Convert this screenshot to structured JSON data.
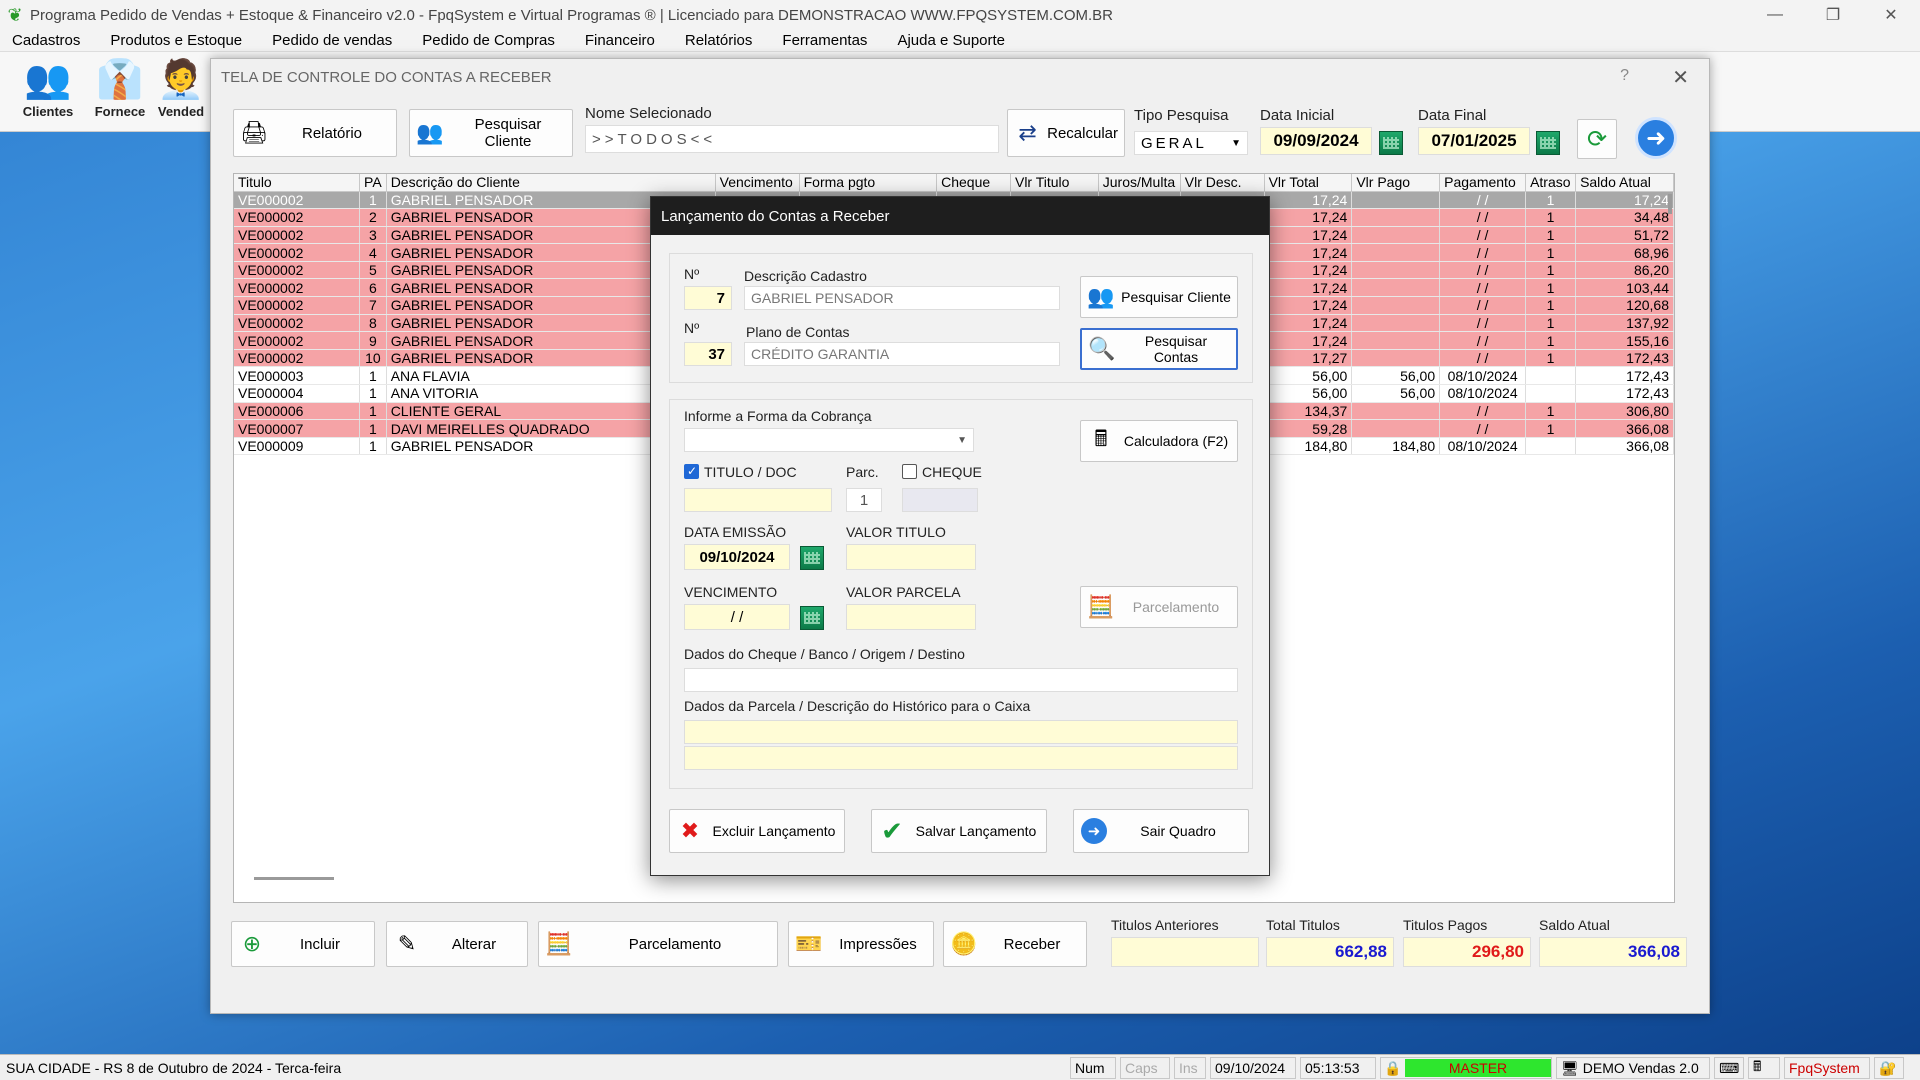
{
  "app": {
    "title": "Programa Pedido de Vendas + Estoque & Financeiro v2.0 - FpqSystem e Virtual Programas ® | Licenciado para  DEMONSTRACAO WWW.FPQSYSTEM.COM.BR",
    "window_controls": {
      "minimize": "—",
      "restore": "❐",
      "close": "✕"
    }
  },
  "menu": [
    "Cadastros",
    "Produtos e Estoque",
    "Pedido de vendas",
    "Pedido de Compras",
    "Financeiro",
    "Relatórios",
    "Ferramentas",
    "Ajuda e Suporte"
  ],
  "toolbar": [
    {
      "label": "Clientes",
      "icon": "people-icon"
    },
    {
      "label": "Fornece",
      "icon": "supplier-icon"
    },
    {
      "label": "Vended",
      "icon": "seller-icon"
    }
  ],
  "screen": {
    "title": "TELA DE CONTROLE DO CONTAS A RECEBER",
    "help": "?",
    "close": "✕",
    "btn_relatorio": "Relatório",
    "btn_pesquisar_cliente": "Pesquisar Cliente",
    "nome_selecionado_label": "Nome Selecionado",
    "nome_selecionado_value": ">>TODOS<<",
    "btn_recalcular": "Recalcular",
    "tipo_pesquisa_label": "Tipo  Pesquisa",
    "tipo_pesquisa_value": "GERAL",
    "data_inicial_label": "Data Inicial",
    "data_inicial_value": "09/09/2024",
    "data_final_label": "Data Final",
    "data_final_value": "07/01/2025"
  },
  "grid": {
    "columns": [
      "Titulo",
      "PA",
      "Descrição do Cliente",
      "Vencimento",
      "Forma pgto",
      "Cheque",
      "Vlr Titulo",
      "Juros/Multa",
      "Vlr Desc.",
      "Vlr Total",
      "Vlr Pago",
      "Pagamento",
      "Atraso",
      "Saldo Atual"
    ],
    "rows": [
      {
        "titulo": "VE000002",
        "pa": "1",
        "cliente": "GABRIEL PENSADOR",
        "total": "17,24",
        "pago": "",
        "pagamento": "/ /",
        "atraso": "1",
        "saldo": "17,24",
        "style": "sel"
      },
      {
        "titulo": "VE000002",
        "pa": "2",
        "cliente": "GABRIEL PENSADOR",
        "total": "17,24",
        "pago": "",
        "pagamento": "/ /",
        "atraso": "1",
        "saldo": "34,48",
        "style": "pink"
      },
      {
        "titulo": "VE000002",
        "pa": "3",
        "cliente": "GABRIEL PENSADOR",
        "total": "17,24",
        "pago": "",
        "pagamento": "/ /",
        "atraso": "1",
        "saldo": "51,72",
        "style": "pink"
      },
      {
        "titulo": "VE000002",
        "pa": "4",
        "cliente": "GABRIEL PENSADOR",
        "total": "17,24",
        "pago": "",
        "pagamento": "/ /",
        "atraso": "1",
        "saldo": "68,96",
        "style": "pink"
      },
      {
        "titulo": "VE000002",
        "pa": "5",
        "cliente": "GABRIEL PENSADOR",
        "total": "17,24",
        "pago": "",
        "pagamento": "/ /",
        "atraso": "1",
        "saldo": "86,20",
        "style": "pink"
      },
      {
        "titulo": "VE000002",
        "pa": "6",
        "cliente": "GABRIEL PENSADOR",
        "total": "17,24",
        "pago": "",
        "pagamento": "/ /",
        "atraso": "1",
        "saldo": "103,44",
        "style": "pink"
      },
      {
        "titulo": "VE000002",
        "pa": "7",
        "cliente": "GABRIEL PENSADOR",
        "total": "17,24",
        "pago": "",
        "pagamento": "/ /",
        "atraso": "1",
        "saldo": "120,68",
        "style": "pink"
      },
      {
        "titulo": "VE000002",
        "pa": "8",
        "cliente": "GABRIEL PENSADOR",
        "total": "17,24",
        "pago": "",
        "pagamento": "/ /",
        "atraso": "1",
        "saldo": "137,92",
        "style": "pink"
      },
      {
        "titulo": "VE000002",
        "pa": "9",
        "cliente": "GABRIEL PENSADOR",
        "total": "17,24",
        "pago": "",
        "pagamento": "/ /",
        "atraso": "1",
        "saldo": "155,16",
        "style": "pink"
      },
      {
        "titulo": "VE000002",
        "pa": "10",
        "cliente": "GABRIEL PENSADOR",
        "total": "17,27",
        "pago": "",
        "pagamento": "/ /",
        "atraso": "1",
        "saldo": "172,43",
        "style": "pink"
      },
      {
        "titulo": "VE000003",
        "pa": "1",
        "cliente": "ANA FLAVIA",
        "total": "56,00",
        "pago": "56,00",
        "pagamento": "08/10/2024",
        "atraso": "",
        "saldo": "172,43",
        "style": "white"
      },
      {
        "titulo": "VE000004",
        "pa": "1",
        "cliente": "ANA VITORIA",
        "total": "56,00",
        "pago": "56,00",
        "pagamento": "08/10/2024",
        "atraso": "",
        "saldo": "172,43",
        "style": "white"
      },
      {
        "titulo": "VE000006",
        "pa": "1",
        "cliente": "CLIENTE GERAL",
        "total": "134,37",
        "pago": "",
        "pagamento": "/ /",
        "atraso": "1",
        "saldo": "306,80",
        "style": "pink"
      },
      {
        "titulo": "VE000007",
        "pa": "1",
        "cliente": "DAVI MEIRELLES QUADRADO",
        "total": "59,28",
        "pago": "",
        "pagamento": "/ /",
        "atraso": "1",
        "saldo": "366,08",
        "style": "pink"
      },
      {
        "titulo": "VE000009",
        "pa": "1",
        "cliente": "GABRIEL PENSADOR",
        "total": "184,80",
        "pago": "184,80",
        "pagamento": "08/10/2024",
        "atraso": "",
        "saldo": "366,08",
        "style": "white"
      }
    ]
  },
  "bottom": {
    "incluir": "Incluir",
    "alterar": "Alterar",
    "parcelamento": "Parcelamento",
    "impressoes": "Impressões",
    "receber": "Receber",
    "titulos_anteriores_label": "Titulos Anteriores",
    "titulos_anteriores_value": "",
    "total_titulos_label": "Total Titulos",
    "total_titulos_value": "662,88",
    "titulos_pagos_label": "Titulos Pagos",
    "titulos_pagos_value": "296,80",
    "saldo_atual_label": "Saldo Atual",
    "saldo_atual_value": "366,08"
  },
  "dialog": {
    "title": "Lançamento do Contas a Receber",
    "n_label": "Nº",
    "descricao_label": "Descrição Cadastro",
    "cliente_n": "7",
    "cliente_nome": "GABRIEL PENSADOR",
    "plano_label": "Plano de Contas",
    "plano_n": "37",
    "plano_nome": "CRÉDITO GARANTIA",
    "btn_pesquisar_cliente": "Pesquisar Cliente",
    "btn_pesquisar_contas": "Pesquisar Contas",
    "forma_label": "Informe a Forma da Cobrança",
    "forma_value": "",
    "btn_calculadora": "Calculadora (F2)",
    "titulo_doc_label": "TITULO / DOC",
    "titulo_doc_checked": true,
    "titulo_doc_value": "",
    "parc_label": "Parc.",
    "parc_value": "1",
    "cheque_label": "CHEQUE",
    "cheque_checked": false,
    "cheque_value": "",
    "data_emissao_label": "DATA EMISSÃO",
    "data_emissao_value": "09/10/2024",
    "valor_titulo_label": "VALOR TITULO",
    "valor_titulo_value": "",
    "vencimento_label": "VENCIMENTO",
    "vencimento_value": "/ /",
    "valor_parcela_label": "VALOR PARCELA",
    "valor_parcela_value": "",
    "btn_parcelamento": "Parcelamento",
    "cheque_dados_label": "Dados do Cheque / Banco / Origem / Destino",
    "cheque_dados_value": "",
    "parcela_dados_label": "Dados da Parcela / Descrição do Histórico para o Caixa",
    "parcela_linha1": "",
    "parcela_linha2": "",
    "btn_excluir": "Excluir Lançamento",
    "btn_salvar": "Salvar Lançamento",
    "btn_sair": "Sair Quadro"
  },
  "status": {
    "location": "SUA CIDADE - RS  8 de Outubro de 2024 - Terca-feira",
    "num": "Num",
    "caps": "Caps",
    "ins": "Ins",
    "date": "09/10/2024",
    "time": "05:13:53",
    "user": "MASTER",
    "system": "DEMO Vendas 2.0",
    "brand": "FpqSystem"
  }
}
